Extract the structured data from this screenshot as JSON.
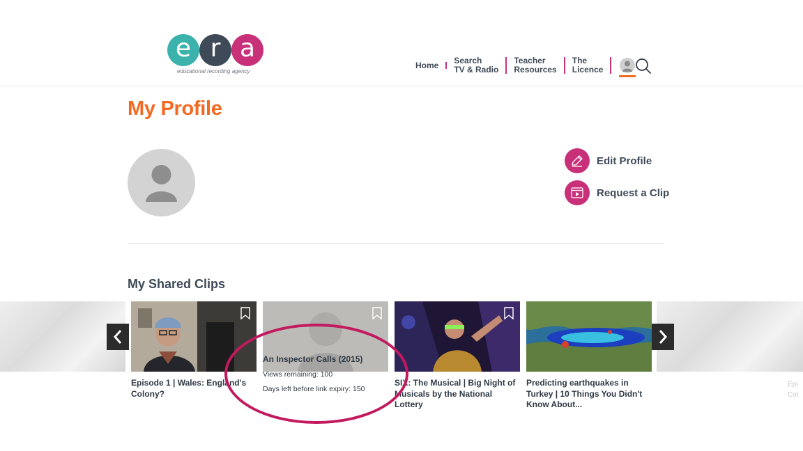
{
  "brand": {
    "letters": [
      "e",
      "r",
      "a"
    ],
    "tagline": "educational recording agency",
    "colors": {
      "teal": "#3bb3ac",
      "slate": "#3e4a57",
      "magenta": "#c8317a",
      "orange": "#f26a21"
    }
  },
  "nav": {
    "home": "Home",
    "search_line1": "Search",
    "search_line2": "TV & Radio",
    "teacher_line1": "Teacher",
    "teacher_line2": "Resources",
    "licence_line1": "The",
    "licence_line2": "Licence",
    "user_icon": "user-icon",
    "search_icon": "search-icon"
  },
  "profile": {
    "title": "My Profile",
    "edit_label": "Edit Profile",
    "request_label": "Request a Clip"
  },
  "clips": {
    "section_title": "My Shared Clips",
    "items": [
      {
        "title": "Episode 1 | Wales: England's Colony?"
      },
      {
        "title": "An Inspector Calls (2015)",
        "views_label": "Views remaining:",
        "views_value": "100",
        "expiry_label": "Days left before link expiry:",
        "expiry_value": "150"
      },
      {
        "title": "SIX: The Musical | Big Night of Musicals by the National Lottery"
      },
      {
        "title": "Predicting earthquakes in Turkey | 10 Things You Didn't Know About..."
      }
    ],
    "partial_next_line1": "Epi",
    "partial_next_line2": "Col"
  }
}
